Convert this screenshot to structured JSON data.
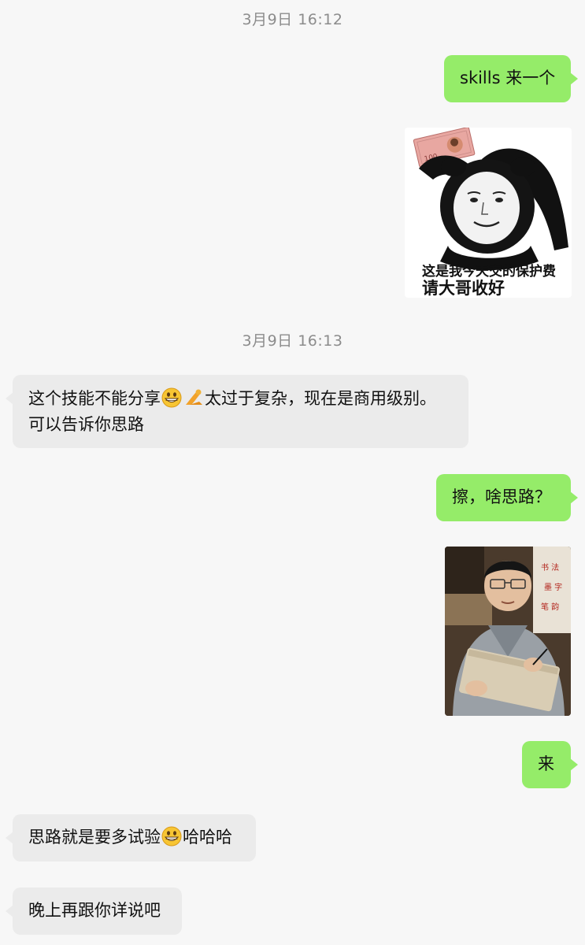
{
  "timestamps": [
    "3月9日 16:12",
    "3月9日 16:13"
  ],
  "messages": {
    "m1": "skills 来一个",
    "m3_part1": "这个技能不能分享",
    "m3_part2": "太过于复杂，现在是商用级别。",
    "m3_line2": "可以告诉你思路",
    "m4": "擦，啥思路？",
    "m6": "来",
    "m7_part1": "思路就是要多试验",
    "m7_part2": "哈哈哈",
    "m8": "晚上再跟你详说吧"
  },
  "sticker": {
    "caption_line1": "这是我今天交的保护费",
    "caption_line2": "请大哥收好",
    "banknote_text": "100"
  },
  "icons": {
    "grin_emoji": "grinning-face-emoji",
    "bow_emoji": "bowing-man-emoji"
  },
  "colors": {
    "background": "#f7f7f7",
    "outgoing_bubble": "#95ec69",
    "incoming_bubble": "#ebebeb",
    "timestamp": "#8c8c8c"
  }
}
